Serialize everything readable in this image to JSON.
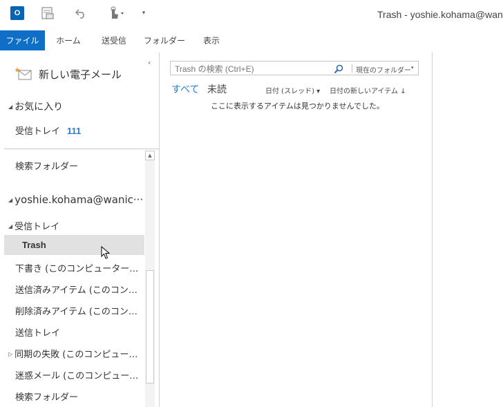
{
  "window": {
    "title": "Trash - yoshie.kohama@wanich"
  },
  "quick_access": {
    "app_icon": "outlook-icon",
    "app_icon_letter": "O",
    "icons": [
      "outlook-icon",
      "send-receive-all-icon",
      "undo-icon",
      "touch-mode-icon",
      "customize-toolbar-icon"
    ],
    "more_glyph": "▾"
  },
  "ribbon": {
    "tabs": [
      "ファイル",
      "ホーム",
      "送受信",
      "フォルダー",
      "表示"
    ],
    "active_color": "#0f6fc6"
  },
  "nav": {
    "collapse_glyph": "‹",
    "new_mail": "新しい電子メール",
    "favorites_header": "お気に入り",
    "favorites_inbox": "受信トレイ",
    "favorites_inbox_count": "111",
    "search_folder": "検索フォルダー",
    "account": "yoshie.kohama@wanic···",
    "inbox": "受信トレイ",
    "selected_folder": "Trash",
    "folders": {
      "drafts": "下書き (このコンピューターのみ)",
      "sent": "送信済みアイテム (このコンピュ···",
      "deleted": "削除済みアイテム (このコンピュ···",
      "outbox": "送信トレイ",
      "sync_failures": "同期の失敗 (このコンピューター···",
      "junk": "迷惑メール (このコンピューターの···",
      "search_folder_2": "検索フォルダー"
    },
    "count_color": "#2b7bd0"
  },
  "message_list": {
    "search_placeholder": "Trash の検索 (Ctrl+E)",
    "search_scope": "現在のフォルダー",
    "filter_all": "すべて",
    "filter_unread": "未読",
    "arrange_by": "日付 (スレッド)",
    "sort_order": "日付の新しいアイテム",
    "sort_arrow": "↓",
    "dropdown_glyph": "▾",
    "empty_message": "ここに表示するアイテムは見つかりませんでした。"
  }
}
